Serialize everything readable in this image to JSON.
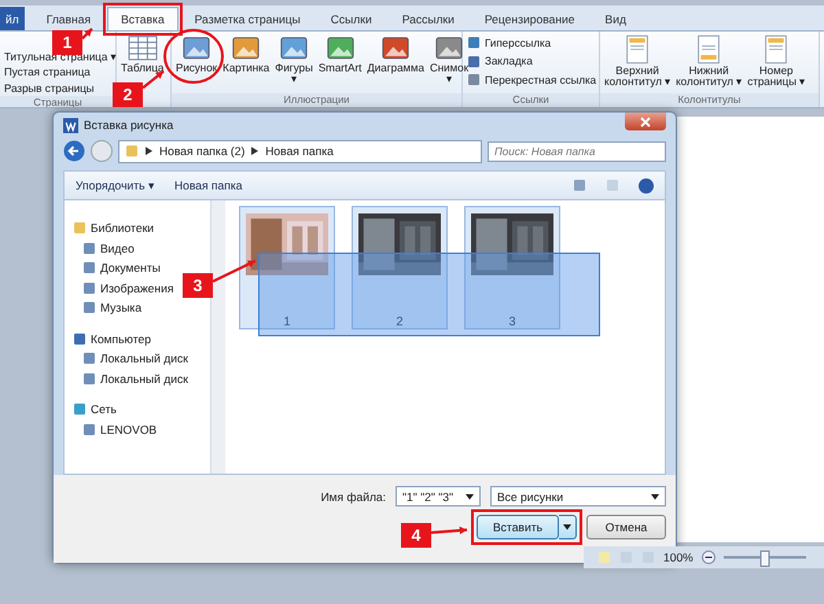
{
  "ribbon_tabs": [
    {
      "label": "йл",
      "kind": "file",
      "selected": false
    },
    {
      "label": "Главная",
      "kind": "tab",
      "selected": false
    },
    {
      "label": "Вставка",
      "kind": "tab",
      "selected": true
    },
    {
      "label": "Разметка страницы",
      "kind": "tab",
      "selected": false
    },
    {
      "label": "Ссылки",
      "kind": "tab",
      "selected": false
    },
    {
      "label": "Рассылки",
      "kind": "tab",
      "selected": false
    },
    {
      "label": "Рецензирование",
      "kind": "tab",
      "selected": false
    },
    {
      "label": "Вид",
      "kind": "tab",
      "selected": false
    }
  ],
  "ribbon_groups": [
    {
      "label": "Страницы",
      "kind": "small",
      "items": [
        {
          "label": "Титульная страница ▾"
        },
        {
          "label": "Пустая страница"
        },
        {
          "label": "Разрыв страницы"
        }
      ]
    },
    {
      "kind": "large",
      "items": [
        {
          "label": "Таблица"
        }
      ]
    },
    {
      "label": "Иллюстрации",
      "kind": "large",
      "items": [
        {
          "label": "Рисунок"
        },
        {
          "label": "Картинка"
        },
        {
          "label": "Фигуры ▾"
        },
        {
          "label": "SmartArt"
        },
        {
          "label": "Диаграмма"
        },
        {
          "label": "Снимок ▾"
        }
      ]
    },
    {
      "label": "Ссылки",
      "kind": "small",
      "items": [
        {
          "label": "Гиперссылка"
        },
        {
          "label": "Закладка"
        },
        {
          "label": "Перекрестная ссылка"
        }
      ]
    },
    {
      "label": "Колонтитулы",
      "kind": "large",
      "items": [
        {
          "label": "Верхний колонтитул ▾"
        },
        {
          "label": "Нижний колонтитул ▾"
        },
        {
          "label": "Номер страницы ▾"
        }
      ]
    }
  ],
  "dialog": {
    "title": "Вставка рисунка",
    "breadcrumb": [
      "Новая папка (2)",
      "Новая папка"
    ],
    "search": {
      "placeholder": "Поиск: Новая папка"
    },
    "toolbar": [
      "Упорядочить ▾",
      "Новая папка"
    ],
    "nav": [
      {
        "label": "Библиотеки",
        "children": [
          {
            "label": "Видео"
          },
          {
            "label": "Документы"
          },
          {
            "label": "Изображения"
          },
          {
            "label": "Музыка"
          }
        ]
      },
      {
        "label": "Компьютер",
        "children": [
          {
            "label": "Локальный диск"
          },
          {
            "label": "Локальный диск"
          }
        ]
      },
      {
        "label": "Сеть",
        "children": [
          {
            "label": "LENOVOB"
          }
        ]
      }
    ],
    "files": [
      {
        "name": "1",
        "selected": true
      },
      {
        "name": "2",
        "selected": true
      },
      {
        "name": "3",
        "selected": true
      }
    ],
    "filename_label": "Имя файла:",
    "filename": "\"1\" \"2\" \"3\"",
    "filter": "Все рисунки",
    "buttons": [
      "Вставить",
      "Отмена"
    ]
  },
  "status_bar": {
    "zoom": "100%",
    "zoom_slider": {
      "level": 0.5
    }
  },
  "annotations": [
    "1",
    "2",
    "3",
    "4"
  ]
}
